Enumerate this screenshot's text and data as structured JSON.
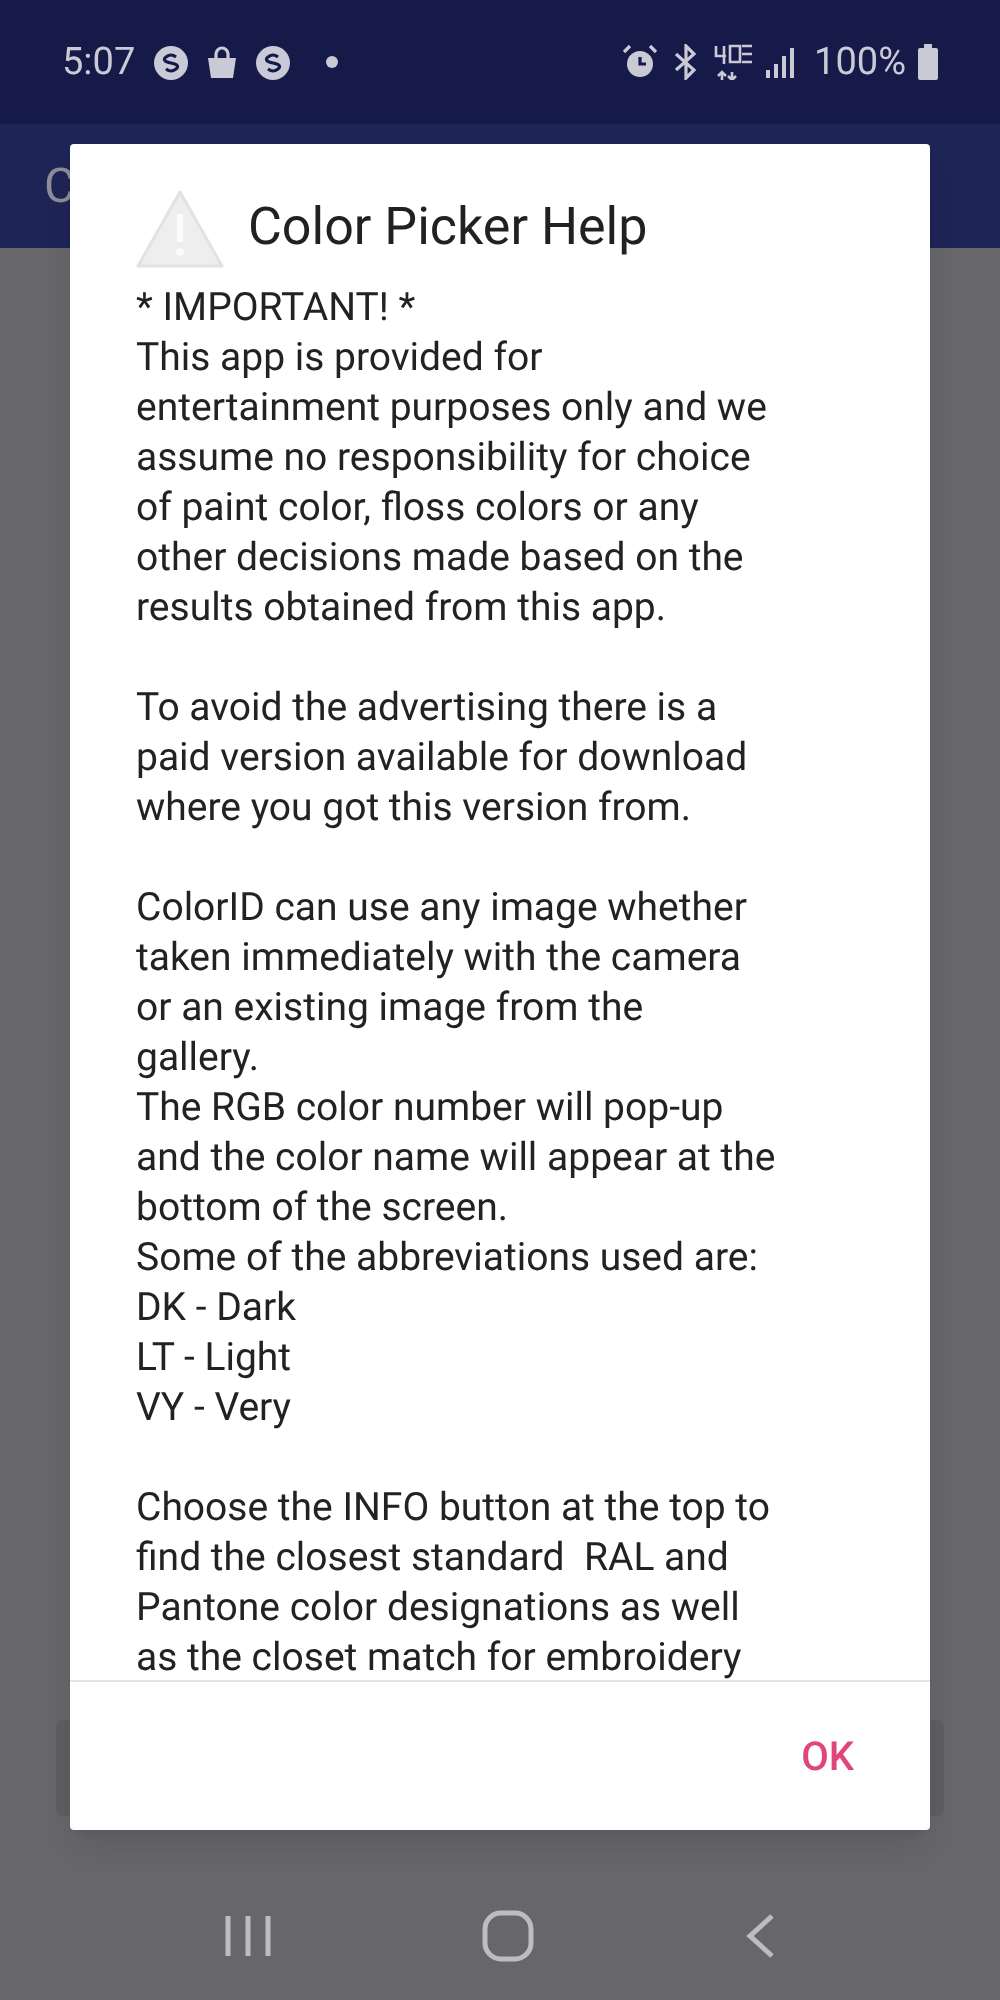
{
  "status_bar": {
    "time": "5:07",
    "battery": "100%"
  },
  "app_bar": {
    "title": "C"
  },
  "dialog": {
    "title": "Color Picker Help",
    "paragraphs": [
      [
        "* IMPORTANT! *",
        "This app is provided for",
        "entertainment purposes only and we",
        "assume no responsibility for choice",
        "of paint color, floss colors or any",
        "other decisions made based on the",
        "results obtained from this app."
      ],
      [
        "To avoid the advertising there is a",
        "paid version available for download",
        "where you got this version from."
      ],
      [
        "ColorID can use any image whether",
        "taken immediately with the camera",
        "or an existing image from the",
        "gallery.",
        "The RGB color number will pop-up",
        "and the color name will appear at the",
        "bottom of the screen.",
        "Some of the abbreviations used are:",
        "DK - Dark",
        "LT - Light",
        "VY - Very"
      ],
      [
        "Choose the INFO button at the top to",
        "find the closest standard  RAL and",
        "Pantone color designations as well",
        "as the closet match for embroidery"
      ]
    ],
    "buttons": [
      "OK"
    ]
  }
}
